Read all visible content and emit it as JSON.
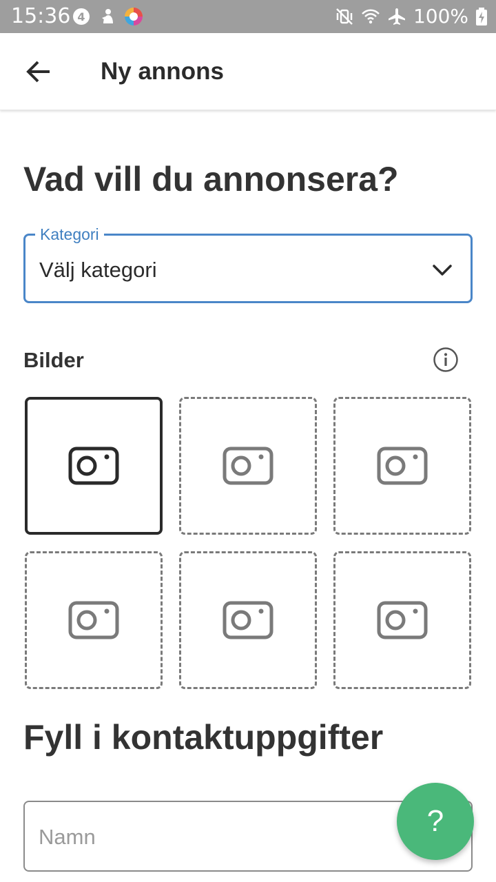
{
  "status_bar": {
    "time": "15:36",
    "battery": "100%",
    "left_icons": [
      "notification-4-icon",
      "person-icon",
      "browser-app-icon"
    ],
    "right_icons": [
      "vibrate-off-icon",
      "wifi-icon",
      "airplane-icon",
      "battery-charging-icon"
    ]
  },
  "app_bar": {
    "back_icon": "arrow-left-icon",
    "title": "Ny annons"
  },
  "main": {
    "heading": "Vad vill du annonsera?",
    "category": {
      "label": "Kategori",
      "value": "Välj kategori",
      "icon": "chevron-down-icon",
      "border_color": "#4a86c8"
    },
    "images": {
      "label": "Bilder",
      "info_icon": "info-icon",
      "slots": [
        {
          "icon": "camera-icon",
          "state": "primary"
        },
        {
          "icon": "camera-icon",
          "state": "empty"
        },
        {
          "icon": "camera-icon",
          "state": "empty"
        },
        {
          "icon": "camera-icon",
          "state": "empty"
        },
        {
          "icon": "camera-icon",
          "state": "empty"
        },
        {
          "icon": "camera-icon",
          "state": "empty"
        }
      ]
    },
    "contact_heading": "Fyll i kontaktuppgifter",
    "name_field": {
      "placeholder": "Namn",
      "value": ""
    }
  },
  "help_fab": {
    "label": "?",
    "color": "#4ab87a"
  }
}
